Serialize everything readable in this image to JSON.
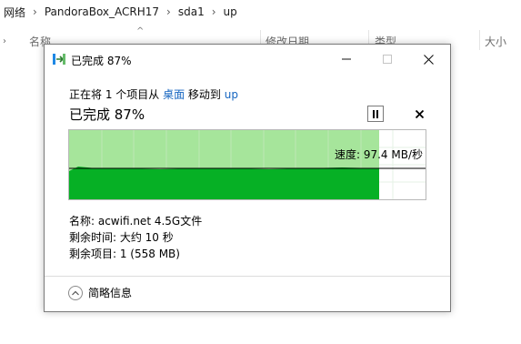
{
  "explorer": {
    "breadcrumbs": [
      "网络",
      "PandoraBox_ACRH17",
      "sda1",
      "up"
    ],
    "columns": [
      {
        "label": "名称"
      },
      {
        "label": "修改日期"
      },
      {
        "label": "类型"
      },
      {
        "label": "大小"
      }
    ]
  },
  "dialog": {
    "title": "已完成 87%",
    "operation": {
      "prefix": "正在将 1 个项目从 ",
      "source": "桌面",
      "middle": " 移动到 ",
      "destination": "up"
    },
    "status": "已完成 87%",
    "progress_fraction": 0.87,
    "speed_label": "速度: 97.4 MB/秒",
    "details": {
      "name": "名称: acwifi.net 4.5G文件",
      "time_left": "剩余时间: 大约 10 秒",
      "items_left": "剩余项目: 1 (558 MB)"
    },
    "fewer_details": "简略信息"
  },
  "colors": {
    "progress_dark": "#06b025",
    "progress_light": "#a6e59b",
    "link": "#1565c0",
    "speed_line": "#000000"
  }
}
